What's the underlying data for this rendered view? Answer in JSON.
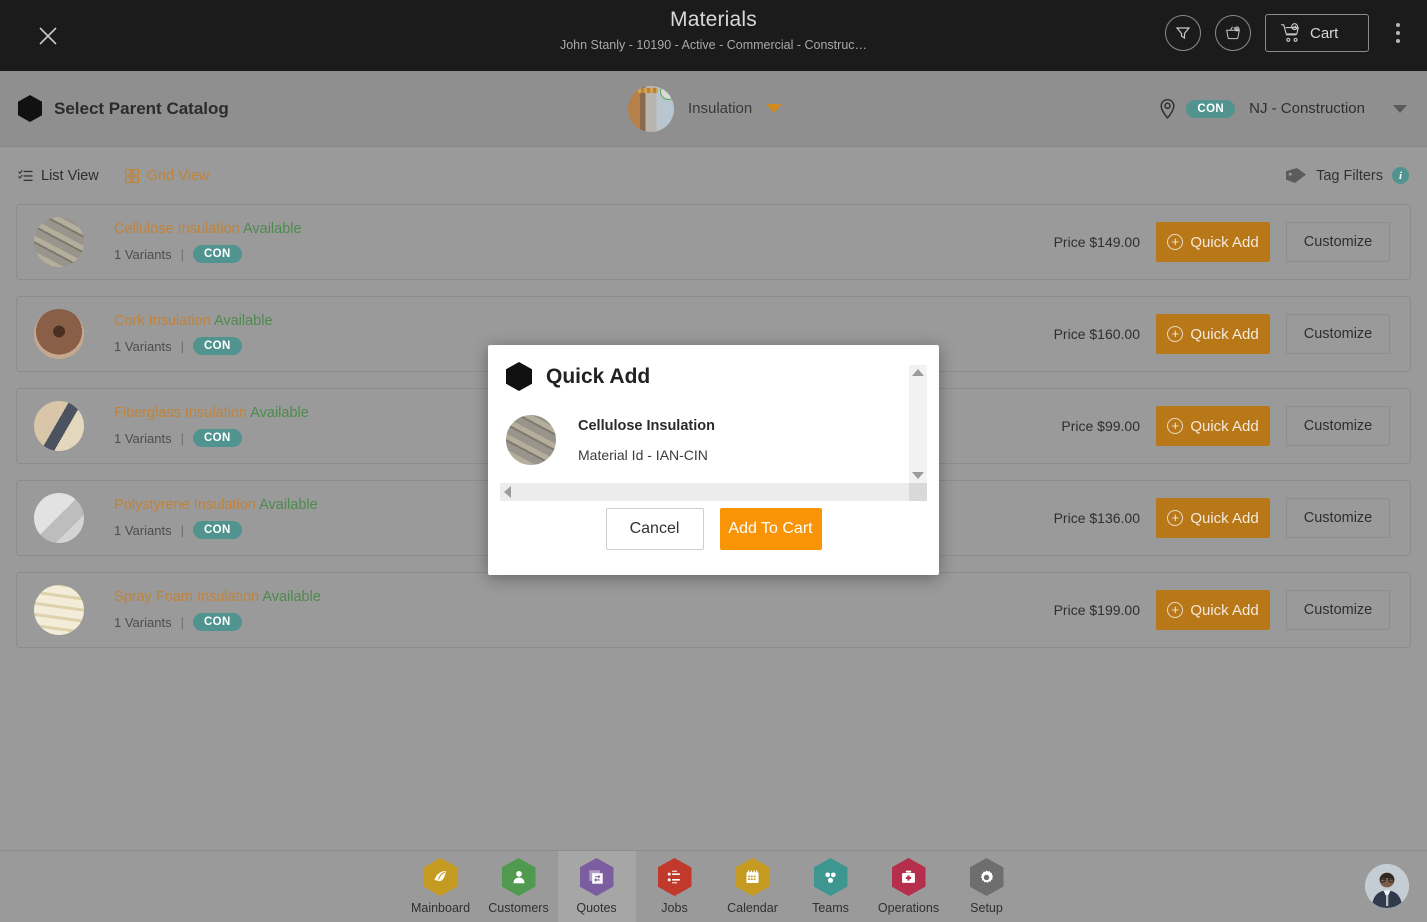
{
  "header": {
    "close_icon": "close-icon",
    "title": "Materials",
    "subtitle": "John Stanly - 10190 - Active - Commercial - Construc…",
    "filter_icon": "filter-funnel-icon",
    "basket_icon": "basket-icon",
    "cart_label": "Cart",
    "cart_icon": "shopping-cart-icon",
    "overflow_icon": "kebab-menu-icon"
  },
  "catalog_bar": {
    "parent_catalog_label": "Select Parent Catalog",
    "hexagon_icon": "hexagon-icon",
    "selected_catalog": "Insulation",
    "catalog_check_icon": "check-circle-icon",
    "catalog_caret_icon": "chevron-down-icon",
    "location_pin_icon": "location-pin-icon",
    "location_chip": "CON",
    "location_name": "NJ - Construction",
    "location_caret_icon": "chevron-down-icon"
  },
  "view_bar": {
    "list_view_label": "List View",
    "list_view_icon": "list-view-icon",
    "grid_view_label": "Grid View",
    "grid_view_icon": "grid-view-icon",
    "tag_filters_label": "Tag Filters",
    "tag_icon": "tag-icon",
    "info_icon": "info-icon",
    "active_view": "List View"
  },
  "list": {
    "quick_add_label": "Quick Add",
    "customize_label": "Customize",
    "plus_icon": "plus-circle-icon",
    "items": [
      {
        "name": "Cellulose Insulation",
        "availability": "Available",
        "variants": "1 Variants",
        "separator": "|",
        "chip": "CON",
        "price": "Price $149.00",
        "thumb_colors": [
          "#8e8a84",
          "#b5ae9d"
        ]
      },
      {
        "name": "Cork Insulation",
        "availability": "Available",
        "variants": "1 Variants",
        "separator": "|",
        "chip": "CON",
        "price": "Price $160.00",
        "thumb_colors": [
          "#8a5f47",
          "#5d3c2b"
        ]
      },
      {
        "name": "Fiberglass Insulation",
        "availability": "Available",
        "variants": "1 Variants",
        "separator": "|",
        "chip": "CON",
        "price": "Price $99.00",
        "thumb_colors": [
          "#d9c6a8",
          "#6c6f78"
        ]
      },
      {
        "name": "Polystyrene Insulation",
        "availability": "Available",
        "variants": "1 Variants",
        "separator": "|",
        "chip": "CON",
        "price": "Price $136.00",
        "thumb_colors": [
          "#d6d6d6",
          "#a9a9a9"
        ]
      },
      {
        "name": "Spray Foam Insulation",
        "availability": "Available",
        "variants": "1 Variants",
        "separator": "|",
        "chip": "CON",
        "price": "Price $199.00",
        "thumb_colors": [
          "#efe9d4",
          "#d8c89a"
        ]
      }
    ]
  },
  "modal": {
    "hexagon_icon": "hexagon-icon",
    "title": "Quick Add",
    "item_name": "Cellulose Insulation",
    "item_id": "Material Id - IAN-CIN",
    "cancel_label": "Cancel",
    "add_to_cart_label": "Add To Cart",
    "vscroll_up_icon": "scroll-up-arrow-icon",
    "vscroll_down_icon": "scroll-down-arrow-icon",
    "hscroll_left_icon": "scroll-left-arrow-icon",
    "hscroll_right_icon": "scroll-right-arrow-icon"
  },
  "bottom_nav": {
    "selected": "Quotes",
    "items": [
      {
        "label": "Mainboard",
        "icon": "mainboard-icon",
        "color": "#c49a21",
        "glyph": "◣"
      },
      {
        "label": "Customers",
        "icon": "customers-icon",
        "color": "#4f9a4f",
        "glyph": "\u0000"
      },
      {
        "label": "Quotes",
        "icon": "quotes-icon",
        "color": "#7c5ea0",
        "glyph": "\u0000"
      },
      {
        "label": "Jobs",
        "icon": "jobs-icon",
        "color": "#c0392b",
        "glyph": "\u0000"
      },
      {
        "label": "Calendar",
        "icon": "calendar-icon",
        "color": "#c49a21",
        "glyph": "\u0000"
      },
      {
        "label": "Teams",
        "icon": "teams-icon",
        "color": "#3d9690",
        "glyph": "\u0000"
      },
      {
        "label": "Operations",
        "icon": "operations-icon",
        "color": "#b52e4c",
        "glyph": "\u0000"
      },
      {
        "label": "Setup",
        "icon": "setup-icon",
        "color": "#6e6e6e",
        "glyph": "\u0000"
      }
    ],
    "avatar_icon": "user-avatar"
  },
  "colors": {
    "accent_orange": "#c1833a",
    "button_orange": "#b87818",
    "modal_orange": "#f89406",
    "teal_chip": "#51938f",
    "available_green": "#4d8b4d",
    "topbar_black": "#1b1b1b",
    "page_grey": "#9a9a9a"
  }
}
